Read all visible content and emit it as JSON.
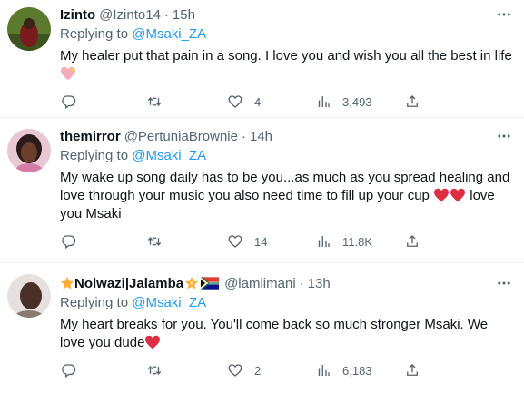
{
  "tweets": [
    {
      "name": "Izinto",
      "handle": "@Izinto14",
      "separator": "·",
      "time": "15h",
      "replying_prefix": "Replying to ",
      "replying_to": "@Msaki_ZA",
      "text": "My healer put that pain in a song. I love you and wish you all the best in life",
      "replies": "",
      "retweets": "",
      "likes": "4",
      "views": "3,493"
    },
    {
      "name": "themirror",
      "handle": "@PertuniaBrownie",
      "separator": "·",
      "time": "14h",
      "replying_prefix": "Replying to ",
      "replying_to": "@Msaki_ZA",
      "text_part1": "My wake up song daily has to be you...as much as you spread healing and love through your music you also need time to fill up your cup",
      "text_part2": " love you Msaki",
      "replies": "",
      "retweets": "",
      "likes": "14",
      "views": "11.8K"
    },
    {
      "name_part1": "Nolwazi",
      "name_part2": "|Jalamba",
      "handle": "@lamlimani",
      "separator": "·",
      "time": "13h",
      "replying_prefix": "Replying to ",
      "replying_to": "@Msaki_ZA",
      "text": "My heart breaks for you. You'll come back so much stronger Msaki. We love you dude",
      "replies": "",
      "retweets": "",
      "likes": "2",
      "views": "6,183"
    }
  ],
  "colors": {
    "text": "#0f1419",
    "secondary": "#536471",
    "link": "#1d9bf0",
    "divider": "#eff3f4",
    "heart_emoji": "#dd2e44"
  },
  "icons": [
    "reply-icon",
    "retweet-icon",
    "like-icon",
    "views-icon",
    "share-icon",
    "more-icon"
  ]
}
